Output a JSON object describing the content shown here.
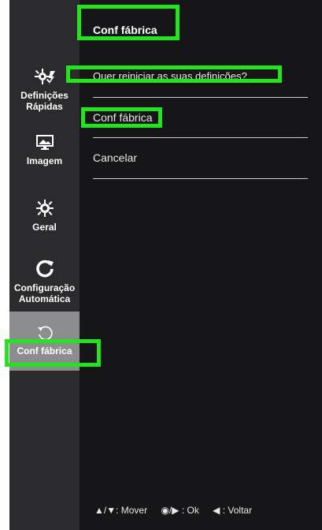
{
  "header": {
    "title": "Conf fábrica"
  },
  "sidebar": {
    "items": [
      {
        "label_line1": "Definições",
        "label_line2": "Rápidas",
        "icon": "quick-settings-icon"
      },
      {
        "label": "Imagem",
        "icon": "picture-icon"
      },
      {
        "label": "Geral",
        "icon": "gear-icon"
      },
      {
        "label_line1": "Configuração",
        "label_line2": "Automática",
        "icon": "auto-config-icon"
      },
      {
        "label": "Conf fábrica",
        "icon": "reset-icon",
        "active": true
      }
    ]
  },
  "main": {
    "question": "Quer reiniciar as suas definições?",
    "options": [
      {
        "label": "Conf fábrica",
        "selected": true
      },
      {
        "label": "Cancelar",
        "selected": false
      }
    ]
  },
  "footer": {
    "move": "▲/▼: Mover",
    "ok": "◉/▶ : Ok",
    "back": "◀ : Voltar"
  },
  "colors": {
    "highlight": "#22e51e",
    "active_item": "#8d8d90",
    "background": "#161618"
  }
}
